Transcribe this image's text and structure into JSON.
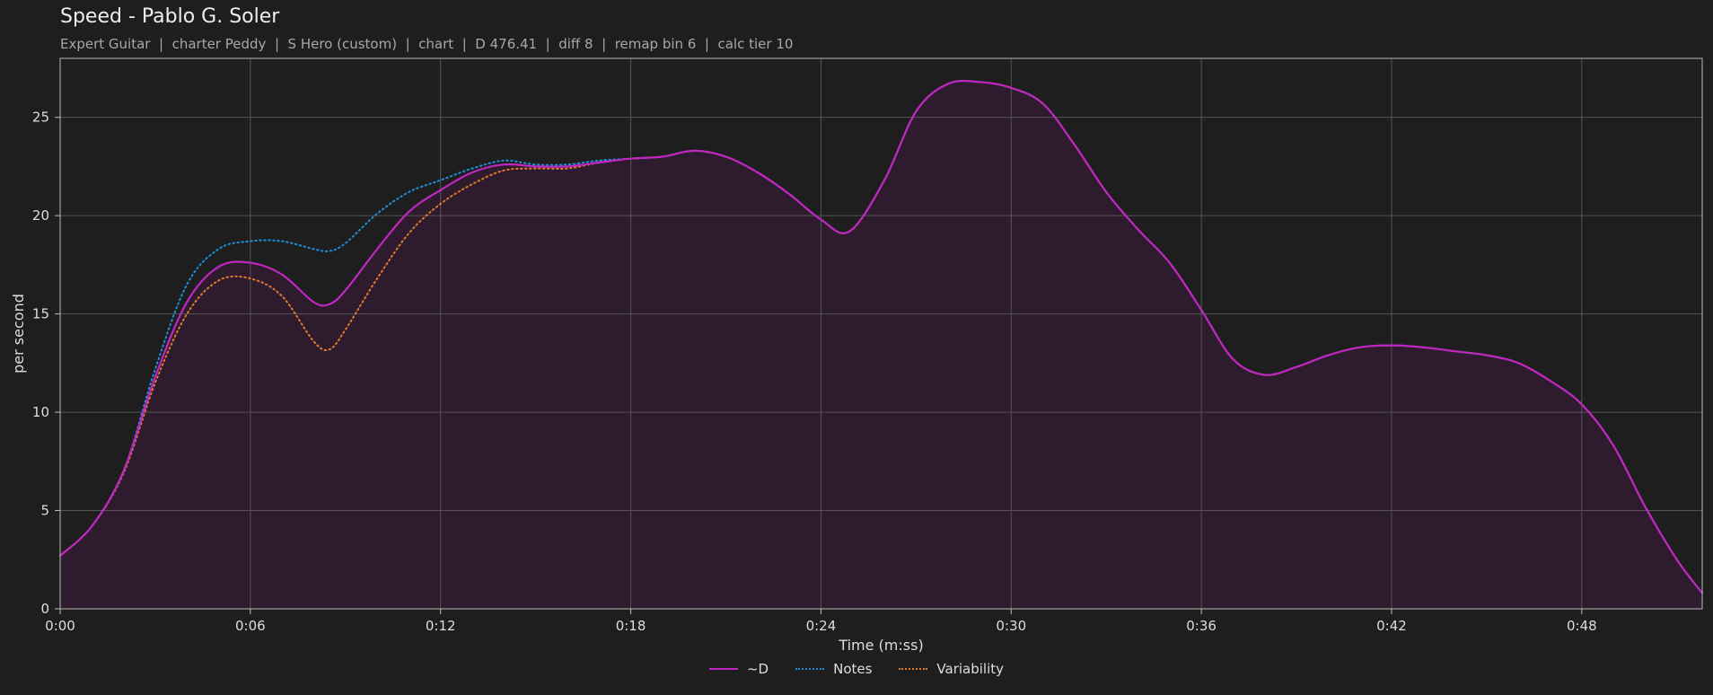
{
  "chart_data": {
    "type": "area",
    "title": "Speed - Pablo G. Soler",
    "subtitle": "Expert Guitar  |  charter Peddy  |  S Hero (custom)  |  chart  |  D 476.41  |  diff 8  |  remap bin 6  |  calc tier 10",
    "xlabel": "Time (m:ss)",
    "ylabel": "per second",
    "xlim": [
      0,
      51.8
    ],
    "ylim": [
      0,
      28
    ],
    "x_ticks": [
      {
        "v": 0,
        "label": "0:00"
      },
      {
        "v": 6,
        "label": "0:06"
      },
      {
        "v": 12,
        "label": "0:12"
      },
      {
        "v": 18,
        "label": "0:18"
      },
      {
        "v": 24,
        "label": "0:24"
      },
      {
        "v": 30,
        "label": "0:30"
      },
      {
        "v": 36,
        "label": "0:36"
      },
      {
        "v": 42,
        "label": "0:42"
      },
      {
        "v": 48,
        "label": "0:48"
      }
    ],
    "y_ticks": [
      {
        "v": 0,
        "label": "0"
      },
      {
        "v": 5,
        "label": "5"
      },
      {
        "v": 10,
        "label": "10"
      },
      {
        "v": 15,
        "label": "15"
      },
      {
        "v": 20,
        "label": "20"
      },
      {
        "v": 25,
        "label": "25"
      }
    ],
    "grid": true,
    "legend_position": "bottom-center",
    "colors": {
      "background": "#1e1e1e",
      "fill": "#2e1c2e",
      "grid": "#555555",
      "axis": "#bbbbbb"
    },
    "series": [
      {
        "name": "~D",
        "color": "#c027c0",
        "style": "solid",
        "points": [
          [
            0,
            2.7
          ],
          [
            1,
            4.2
          ],
          [
            2,
            7.0
          ],
          [
            3,
            11.8
          ],
          [
            4,
            15.6
          ],
          [
            5,
            17.4
          ],
          [
            6,
            17.6
          ],
          [
            7,
            17.0
          ],
          [
            8,
            15.6
          ],
          [
            8.5,
            15.5
          ],
          [
            9,
            16.2
          ],
          [
            10,
            18.3
          ],
          [
            11,
            20.2
          ],
          [
            12,
            21.3
          ],
          [
            13,
            22.2
          ],
          [
            14,
            22.6
          ],
          [
            15,
            22.5
          ],
          [
            16,
            22.5
          ],
          [
            17,
            22.7
          ],
          [
            18,
            22.9
          ],
          [
            19,
            23.0
          ],
          [
            20,
            23.3
          ],
          [
            21,
            23.0
          ],
          [
            22,
            22.2
          ],
          [
            23,
            21.1
          ],
          [
            24,
            19.8
          ],
          [
            24.9,
            19.2
          ],
          [
            26,
            21.8
          ],
          [
            27,
            25.3
          ],
          [
            28,
            26.7
          ],
          [
            29,
            26.8
          ],
          [
            30,
            26.5
          ],
          [
            31,
            25.7
          ],
          [
            32,
            23.6
          ],
          [
            33,
            21.2
          ],
          [
            34,
            19.3
          ],
          [
            35,
            17.6
          ],
          [
            36,
            15.2
          ],
          [
            37,
            12.7
          ],
          [
            38,
            11.9
          ],
          [
            39,
            12.3
          ],
          [
            40,
            12.9
          ],
          [
            41,
            13.3
          ],
          [
            42,
            13.4
          ],
          [
            43,
            13.3
          ],
          [
            44,
            13.1
          ],
          [
            45,
            12.9
          ],
          [
            46,
            12.5
          ],
          [
            47,
            11.6
          ],
          [
            48,
            10.4
          ],
          [
            49,
            8.3
          ],
          [
            50,
            5.2
          ],
          [
            51,
            2.5
          ],
          [
            51.8,
            0.8
          ]
        ]
      },
      {
        "name": "Notes",
        "color": "#1f8ed6",
        "style": "dotted",
        "points": [
          [
            0,
            2.7
          ],
          [
            1,
            4.2
          ],
          [
            2,
            7.0
          ],
          [
            3,
            12.2
          ],
          [
            4,
            16.5
          ],
          [
            5,
            18.3
          ],
          [
            6,
            18.7
          ],
          [
            7,
            18.7
          ],
          [
            8,
            18.3
          ],
          [
            8.5,
            18.2
          ],
          [
            9,
            18.6
          ],
          [
            10,
            20.1
          ],
          [
            11,
            21.2
          ],
          [
            12,
            21.8
          ],
          [
            13,
            22.4
          ],
          [
            14,
            22.8
          ],
          [
            15,
            22.6
          ],
          [
            16,
            22.6
          ],
          [
            17,
            22.8
          ],
          [
            18,
            22.9
          ],
          [
            19,
            23.0
          ],
          [
            20,
            23.3
          ],
          [
            21,
            23.0
          ],
          [
            22,
            22.2
          ],
          [
            23,
            21.1
          ],
          [
            24,
            19.8
          ],
          [
            24.9,
            19.2
          ],
          [
            26,
            21.8
          ],
          [
            27,
            25.3
          ],
          [
            28,
            26.7
          ],
          [
            29,
            26.8
          ],
          [
            30,
            26.5
          ],
          [
            31,
            25.7
          ],
          [
            32,
            23.6
          ],
          [
            33,
            21.2
          ],
          [
            34,
            19.3
          ],
          [
            35,
            17.6
          ],
          [
            36,
            15.2
          ],
          [
            37,
            12.7
          ],
          [
            38,
            11.9
          ],
          [
            39,
            12.3
          ],
          [
            40,
            12.9
          ],
          [
            41,
            13.3
          ],
          [
            42,
            13.4
          ],
          [
            43,
            13.3
          ],
          [
            44,
            13.1
          ],
          [
            45,
            12.9
          ],
          [
            46,
            12.5
          ],
          [
            47,
            11.6
          ],
          [
            48,
            10.4
          ],
          [
            49,
            8.3
          ],
          [
            50,
            5.2
          ],
          [
            51,
            2.5
          ],
          [
            51.8,
            0.8
          ]
        ]
      },
      {
        "name": "Variability",
        "color": "#e07a2a",
        "style": "dotted",
        "points": [
          [
            0,
            2.7
          ],
          [
            1,
            4.2
          ],
          [
            2,
            6.9
          ],
          [
            3,
            11.5
          ],
          [
            4,
            15.0
          ],
          [
            5,
            16.7
          ],
          [
            6,
            16.8
          ],
          [
            7,
            15.9
          ],
          [
            8,
            13.6
          ],
          [
            8.5,
            13.2
          ],
          [
            9,
            14.2
          ],
          [
            10,
            16.8
          ],
          [
            11,
            19.1
          ],
          [
            12,
            20.6
          ],
          [
            13,
            21.6
          ],
          [
            14,
            22.3
          ],
          [
            15,
            22.4
          ],
          [
            16,
            22.4
          ],
          [
            17,
            22.7
          ],
          [
            18,
            22.9
          ],
          [
            19,
            23.0
          ],
          [
            20,
            23.3
          ],
          [
            21,
            23.0
          ],
          [
            22,
            22.2
          ],
          [
            23,
            21.1
          ],
          [
            24,
            19.8
          ],
          [
            24.9,
            19.2
          ],
          [
            26,
            21.8
          ],
          [
            27,
            25.3
          ],
          [
            28,
            26.7
          ],
          [
            29,
            26.8
          ],
          [
            30,
            26.5
          ],
          [
            31,
            25.7
          ],
          [
            32,
            23.6
          ],
          [
            33,
            21.2
          ],
          [
            34,
            19.3
          ],
          [
            35,
            17.6
          ],
          [
            36,
            15.2
          ],
          [
            37,
            12.7
          ],
          [
            38,
            11.9
          ],
          [
            39,
            12.3
          ],
          [
            40,
            12.9
          ],
          [
            41,
            13.3
          ],
          [
            42,
            13.4
          ],
          [
            43,
            13.3
          ],
          [
            44,
            13.1
          ],
          [
            45,
            12.9
          ],
          [
            46,
            12.5
          ],
          [
            47,
            11.6
          ],
          [
            48,
            10.4
          ],
          [
            49,
            8.3
          ],
          [
            50,
            5.2
          ],
          [
            51,
            2.5
          ],
          [
            51.8,
            0.8
          ]
        ]
      }
    ]
  }
}
